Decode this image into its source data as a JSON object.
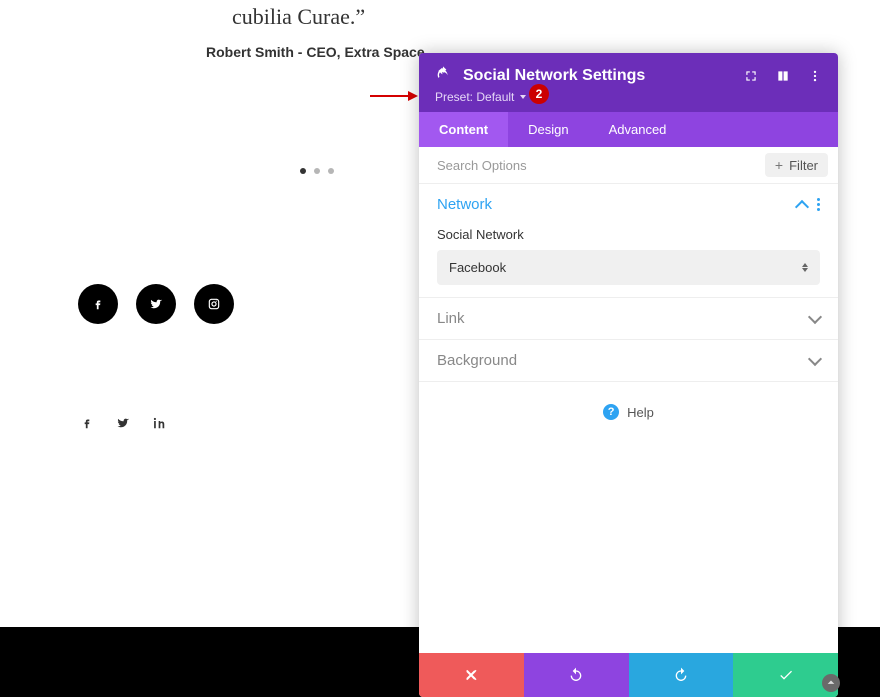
{
  "background": {
    "quote_tail": "cubilia Curae.”",
    "author_line": "Robert Smith - CEO, Extra Space"
  },
  "arrow": {
    "badge": "2"
  },
  "modal": {
    "title": "Social Network Settings",
    "preset_label": "Preset: Default",
    "tabs": {
      "content": "Content",
      "design": "Design",
      "advanced": "Advanced"
    },
    "search_placeholder": "Search Options",
    "filter_label": "Filter",
    "sections": {
      "network": {
        "title": "Network",
        "field_label": "Social Network",
        "field_value": "Facebook"
      },
      "link": {
        "title": "Link"
      },
      "background": {
        "title": "Background"
      }
    },
    "help_label": "Help"
  }
}
